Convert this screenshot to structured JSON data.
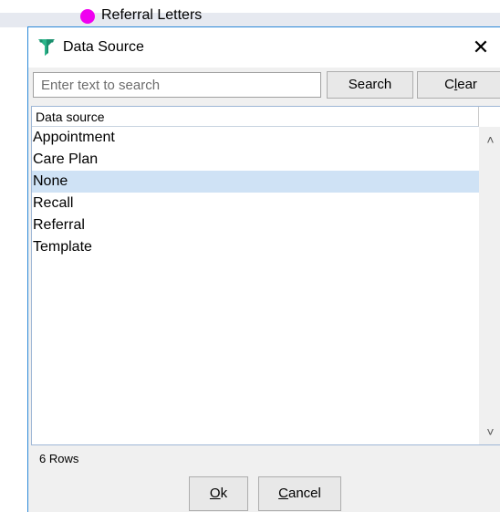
{
  "background": {
    "item_label": "Referral Letters",
    "item_dot_color": "#f000f0"
  },
  "dialog": {
    "title": "Data Source",
    "title_icon": "funnel-filter-icon",
    "close_glyph": "✕",
    "accent_color": "#2b88d8"
  },
  "search": {
    "placeholder": "Enter text to search",
    "value": "",
    "search_label": "Search",
    "clear_label_pre": "C",
    "clear_label_mnemonic": "l",
    "clear_label_post": "ear"
  },
  "grid": {
    "column_header": "Data source",
    "rows": [
      "Appointment",
      "Care Plan",
      "None",
      "Recall",
      "Referral",
      "Template"
    ],
    "selected_index": 2,
    "selected_color": "#cfe2f5"
  },
  "footer": {
    "row_count": "6 Rows",
    "ok_mnemonic": "O",
    "ok_post": "k",
    "cancel_mnemonic": "C",
    "cancel_post": "ancel"
  }
}
